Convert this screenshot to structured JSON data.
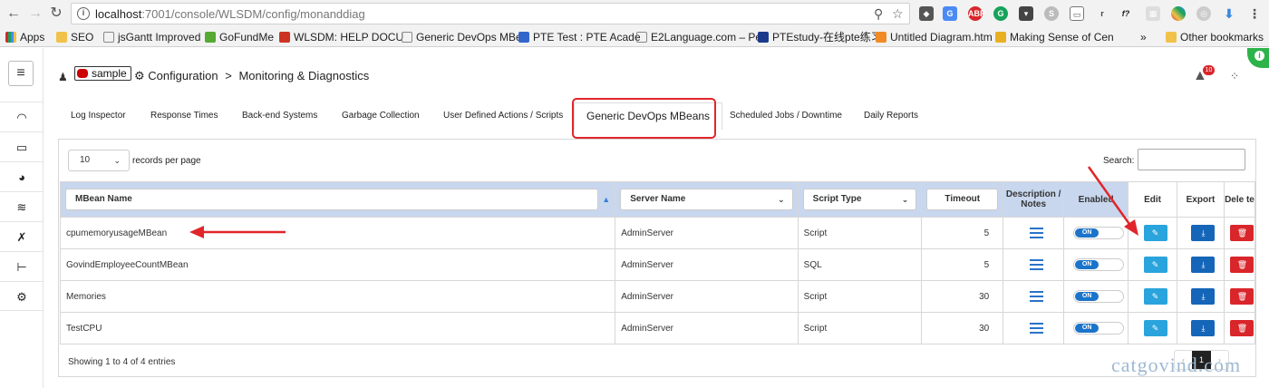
{
  "browser": {
    "url_host": "localhost",
    "url_path": ":7001/console/WLSDM/config/monanddiag",
    "bookmarks": [
      {
        "label": "Apps",
        "color": "#d9262b"
      },
      {
        "label": "SEO",
        "color": "#f0c24a"
      },
      {
        "label": "jsGantt Improved",
        "color": "#888888"
      },
      {
        "label": "GoFundMe",
        "color": "#55aa33"
      },
      {
        "label": "WLSDM: HELP DOCU",
        "color": "#cc3322"
      },
      {
        "label": "Generic DevOps MBe",
        "color": "#888888"
      },
      {
        "label": "PTE Test : PTE Acade",
        "color": "#3366cc"
      },
      {
        "label": "E2Language.com – Pe",
        "color": "#888888"
      },
      {
        "label": "PTEstudy-在线pte练习",
        "color": "#1b3a8c"
      },
      {
        "label": "Untitled Diagram.htm",
        "color": "#f08a24"
      },
      {
        "label": "Making Sense of Cen",
        "color": "#e8b020"
      },
      {
        "label": "»",
        "color": ""
      },
      {
        "label": "Other bookmarks",
        "color": "#f0c24a"
      }
    ]
  },
  "header": {
    "domain": "sample",
    "crumb1": "Configuration",
    "separator": ">",
    "crumb2": "Monitoring & Diagnostics",
    "alert_count": "10"
  },
  "tabs": [
    "Log Inspector",
    "Response Times",
    "Back-end Systems",
    "Garbage Collection",
    "User Defined Actions / Scripts",
    "Generic DevOps MBeans",
    "Scheduled Jobs / Downtime",
    "Daily Reports"
  ],
  "controls": {
    "records_per_page_value": "10",
    "records_per_page_label": "records per page",
    "search_label": "Search:"
  },
  "table": {
    "columns": {
      "mbean": "MBean Name",
      "server": "Server Name",
      "script": "Script Type",
      "timeout": "Timeout",
      "desc": "Description / Notes",
      "enabled": "Enabled",
      "edit": "Edit",
      "export": "Export",
      "delete": "Dele te"
    },
    "rows": [
      {
        "mbean": "cpumemoryusageMBean",
        "server": "AdminServer",
        "script": "Script",
        "timeout": "5",
        "enabled": "ON"
      },
      {
        "mbean": "GovindEmployeeCountMBean",
        "server": "AdminServer",
        "script": "SQL",
        "timeout": "5",
        "enabled": "ON"
      },
      {
        "mbean": "Memories",
        "server": "AdminServer",
        "script": "Script",
        "timeout": "30",
        "enabled": "ON"
      },
      {
        "mbean": "TestCPU",
        "server": "AdminServer",
        "script": "Script",
        "timeout": "30",
        "enabled": "ON"
      }
    ],
    "info": "Showing 1 to 4 of 4 entries",
    "pager": {
      "prev": "‹",
      "current": "1",
      "next": "›"
    }
  },
  "watermark": "catgovind.com",
  "colors": {
    "accent": "#1b74c9",
    "danger": "#d9262b",
    "edit": "#2aa4dd",
    "header_bg": "#c8d7ee",
    "annotation": "#e0262b"
  }
}
